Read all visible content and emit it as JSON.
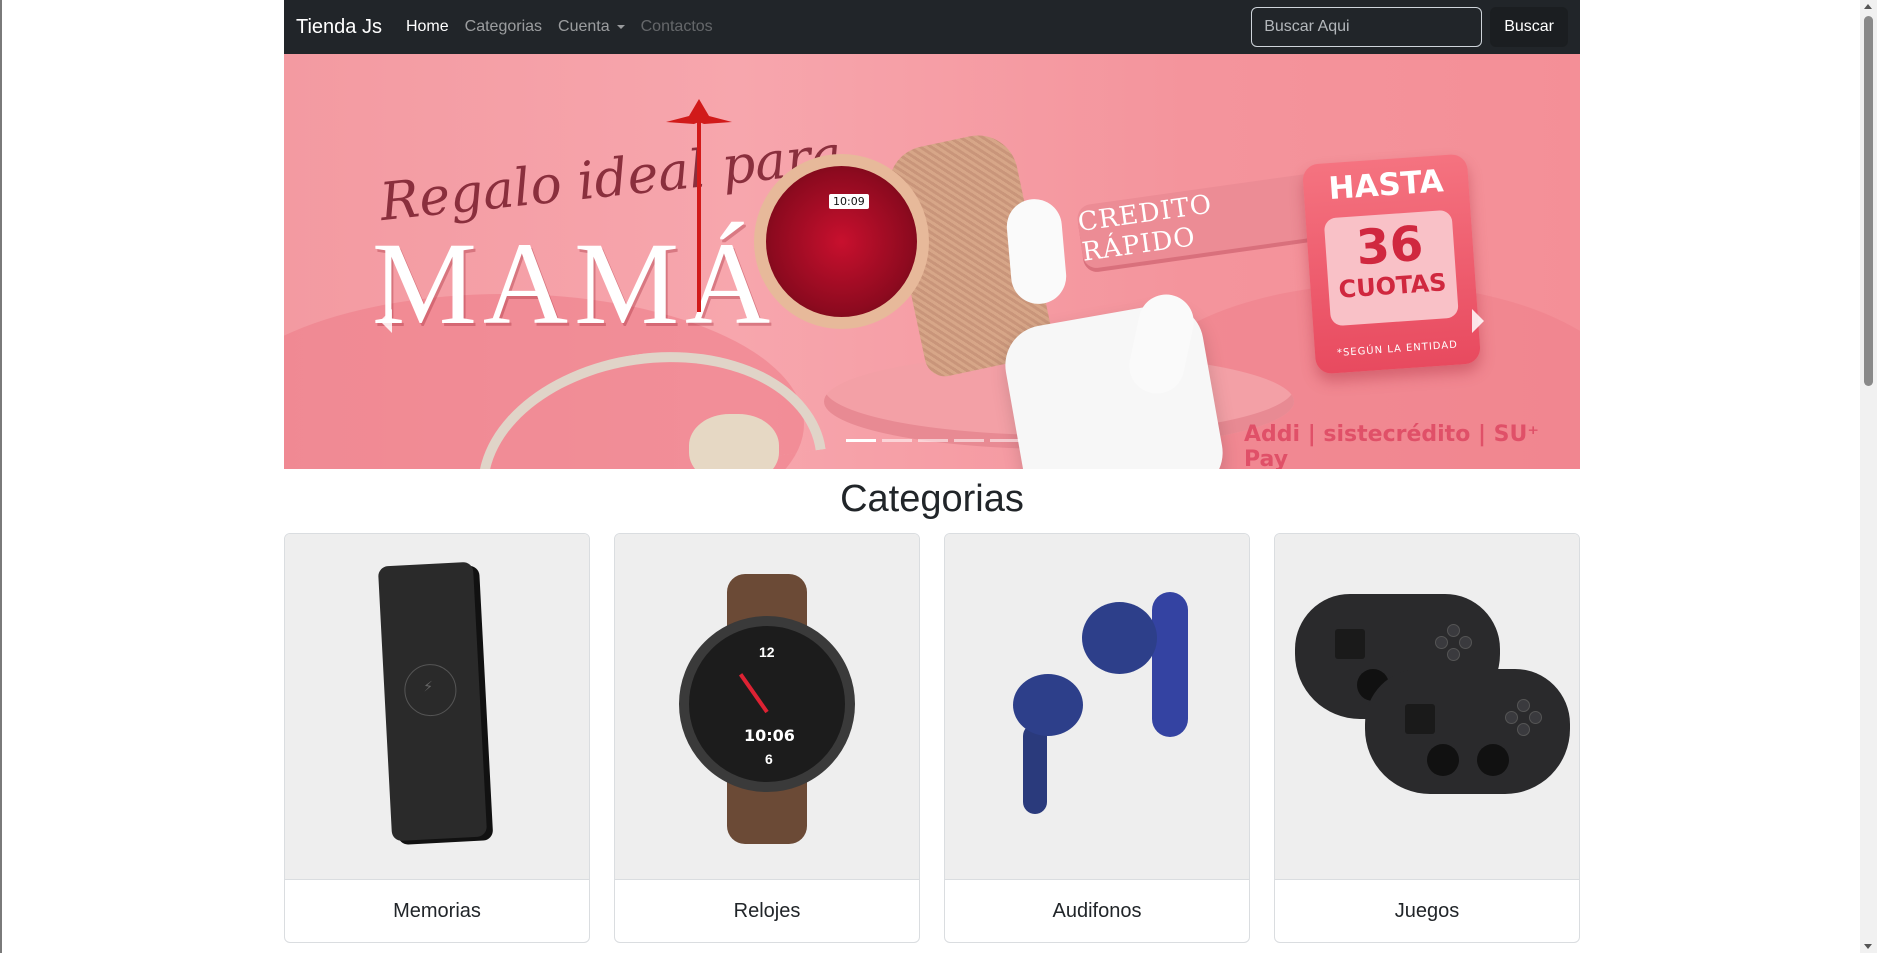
{
  "navbar": {
    "brand": "Tienda Js",
    "links": [
      {
        "label": "Home",
        "state": "active"
      },
      {
        "label": "Categorias",
        "state": "normal"
      },
      {
        "label": "Cuenta",
        "state": "dropdown"
      },
      {
        "label": "Contactos",
        "state": "disabled"
      }
    ],
    "search": {
      "placeholder": "Buscar Aqui",
      "button_label": "Buscar"
    }
  },
  "carousel": {
    "slide": {
      "script_title": "Regalo ideal para",
      "main_title": "MAMÁ",
      "watch_time": "10:09",
      "ribbon_text": "CREDITO RÁPIDO",
      "promo_top": "HASTA",
      "promo_number": "36",
      "promo_unit": "CUOTAS",
      "promo_footnote": "*SEGÚN LA ENTIDAD",
      "partners": "Addi | sistecrédito | SU⁺ Pay"
    },
    "indicator_count": 5,
    "active_indicator": 0
  },
  "categories": {
    "title": "Categorias",
    "items": [
      {
        "label": "Memorias",
        "image": "power-bank"
      },
      {
        "label": "Relojes",
        "image": "smartwatch",
        "watch_time": "10:06",
        "twelve": "12",
        "six": "6"
      },
      {
        "label": "Audifonos",
        "image": "wireless-earbuds"
      },
      {
        "label": "Juegos",
        "image": "game-controllers"
      }
    ]
  },
  "colors": {
    "navbar_bg": "#212529",
    "banner_pink": "#f7a6ad",
    "card_image_bg": "#eeeeee"
  }
}
